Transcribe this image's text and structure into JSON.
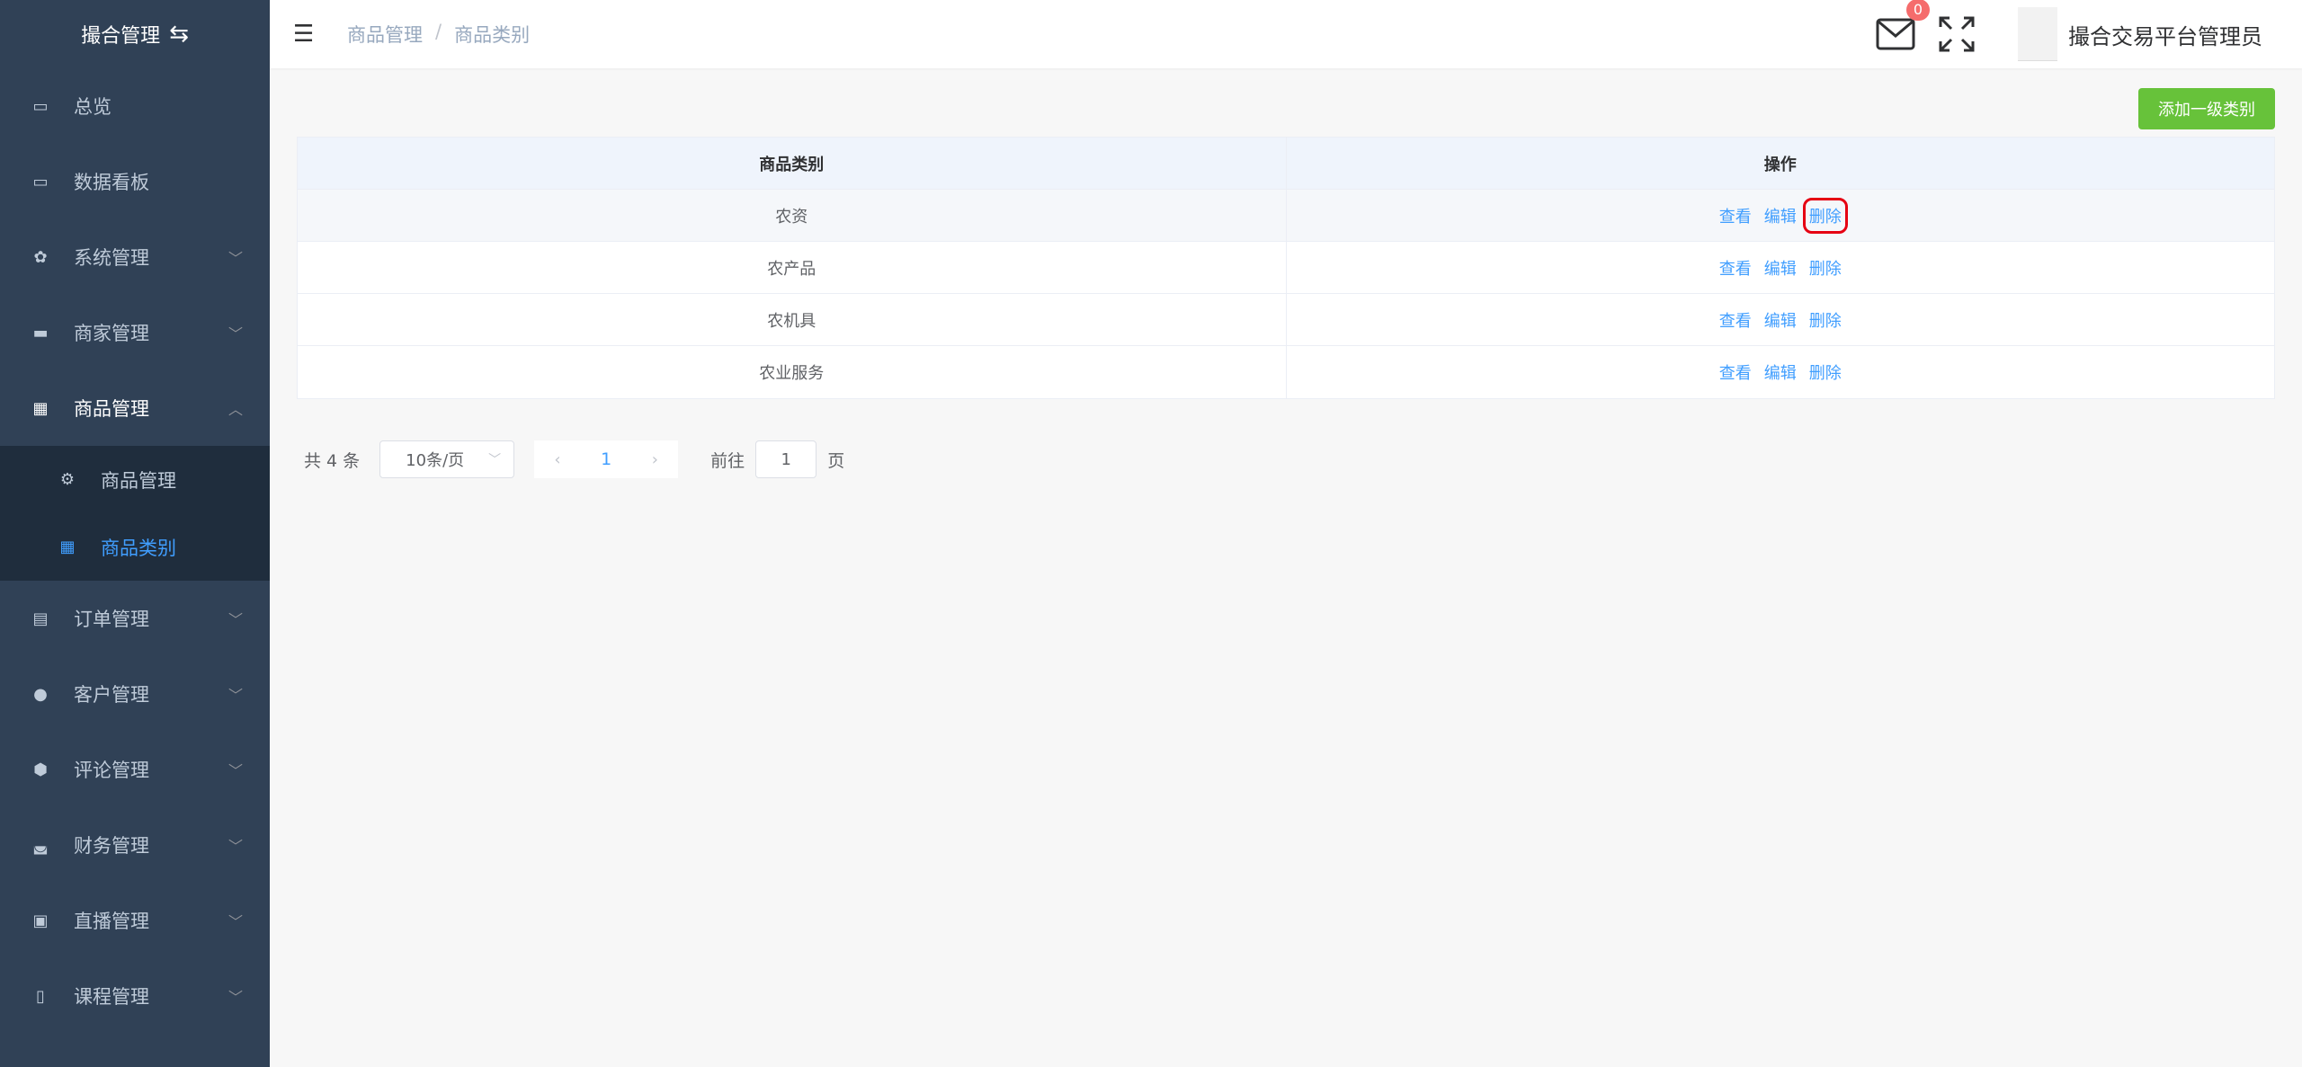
{
  "sidebar": {
    "brand": "撮合管理",
    "items": [
      {
        "label": "总览",
        "icon": "monitor-icon"
      },
      {
        "label": "数据看板",
        "icon": "monitor-icon"
      },
      {
        "label": "系统管理",
        "icon": "gear-icon"
      },
      {
        "label": "商家管理",
        "icon": "store-icon"
      },
      {
        "label": "商品管理",
        "icon": "gift-icon"
      },
      {
        "label": "订单管理",
        "icon": "document-icon"
      },
      {
        "label": "客户管理",
        "icon": "user-icon"
      },
      {
        "label": "评论管理",
        "icon": "comment-icon"
      },
      {
        "label": "财务管理",
        "icon": "wallet-icon"
      },
      {
        "label": "直播管理",
        "icon": "live-icon"
      },
      {
        "label": "课程管理",
        "icon": "book-icon"
      }
    ],
    "submenu": [
      {
        "label": "商品管理",
        "icon": "settings-icon"
      },
      {
        "label": "商品类别",
        "icon": "grid-icon"
      }
    ]
  },
  "header": {
    "breadcrumb": [
      "商品管理",
      "商品类别"
    ],
    "breadcrumb_sep": "/",
    "badge_count": "0",
    "username": "撮合交易平台管理员"
  },
  "toolbar": {
    "add_label": "添加一级类别"
  },
  "table": {
    "headers": [
      "商品类别",
      "操作"
    ],
    "actions": [
      "查看",
      "编辑",
      "删除"
    ],
    "rows": [
      "农资",
      "农产品",
      "农机具",
      "农业服务"
    ]
  },
  "pagination": {
    "total": "共 4 条",
    "page_size": "10条/页",
    "current_page": "1",
    "goto_label": "前往",
    "goto_value": "1",
    "page_suffix": "页"
  },
  "colors": {
    "sidebar_bg": "#304156",
    "active_link": "#409eff",
    "add_button": "#67c23a",
    "badge": "#f56c6c",
    "highlight_box": "#e60012"
  }
}
